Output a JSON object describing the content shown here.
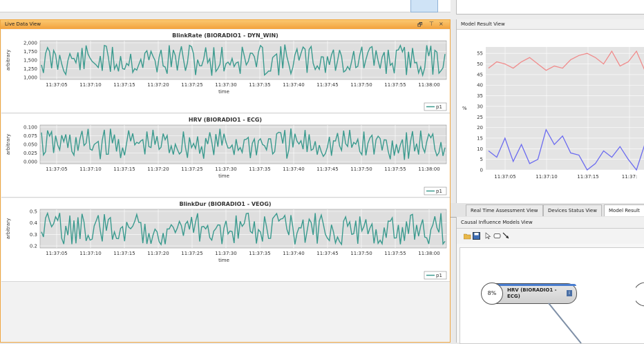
{
  "live_view": {
    "title": "Live Data View",
    "controls": {
      "restore": "🗗",
      "pin": "⊤",
      "close": "×"
    },
    "charts": [
      {
        "title": "BlinkRate (BIORADIO1 - DYN_WIN)",
        "ylabel": "arbitrary",
        "xlabel": "time",
        "legend": "p1",
        "yticks": [
          "2,000",
          "1,750",
          "1,500",
          "1,250",
          "1,000"
        ],
        "ylim": [
          1000,
          2000
        ]
      },
      {
        "title": "HRV (BIORADIO1 - ECG)",
        "ylabel": "arbitrary",
        "xlabel": "time",
        "legend": "p1",
        "yticks": [
          "0.100",
          "0.075",
          "0.050",
          "0.025",
          "0.000"
        ],
        "ylim": [
          0,
          0.1
        ]
      },
      {
        "title": "BlinkDur (BIORADIO1 - VEOG)",
        "ylabel": "arbitrary",
        "xlabel": "time",
        "legend": "p1",
        "yticks": [
          "0.5",
          "0.4",
          "0.3",
          "0.2"
        ],
        "ylim": [
          0.2,
          0.5
        ]
      }
    ],
    "xticks": [
      "11:37:05",
      "11:37:10",
      "11:37:15",
      "11:37:20",
      "11:37:25",
      "11:37:30",
      "11:37:35",
      "11:37:40",
      "11:37:45",
      "11:37:50",
      "11:37:55",
      "11:38:00"
    ],
    "line_color": "#3a9a8e"
  },
  "model_view": {
    "title": "Model Result View",
    "ylabel": "%",
    "yticks": [
      "55",
      "50",
      "45",
      "40",
      "35",
      "30",
      "25",
      "20",
      "15",
      "10",
      "5",
      "0"
    ],
    "xticks": [
      "11:37:05",
      "11:37:10",
      "11:37:15",
      "11:37:"
    ],
    "chart_data": {
      "type": "line",
      "ylim": [
        0,
        58
      ],
      "series": [
        {
          "color": "#f08b8b",
          "values": [
            48,
            51,
            50,
            48,
            51,
            53,
            50,
            47,
            49,
            48,
            52,
            54,
            55,
            53,
            50,
            56,
            49,
            51,
            56,
            47
          ]
        },
        {
          "color": "#6b6bf0",
          "values": [
            9,
            6,
            15,
            4,
            12,
            3,
            5,
            19,
            12,
            16,
            8,
            7,
            0,
            3,
            9,
            6,
            11,
            5,
            0,
            12
          ]
        }
      ]
    }
  },
  "tabs": [
    "Real Time Assessment View",
    "Devices Status View",
    "Model Result"
  ],
  "causal": {
    "title": "Causal Influence Models View",
    "node": {
      "percent": "8%",
      "label_line1": "HRV (BIORADIO1 -",
      "label_line2": "ECG)",
      "badge": "i"
    }
  }
}
